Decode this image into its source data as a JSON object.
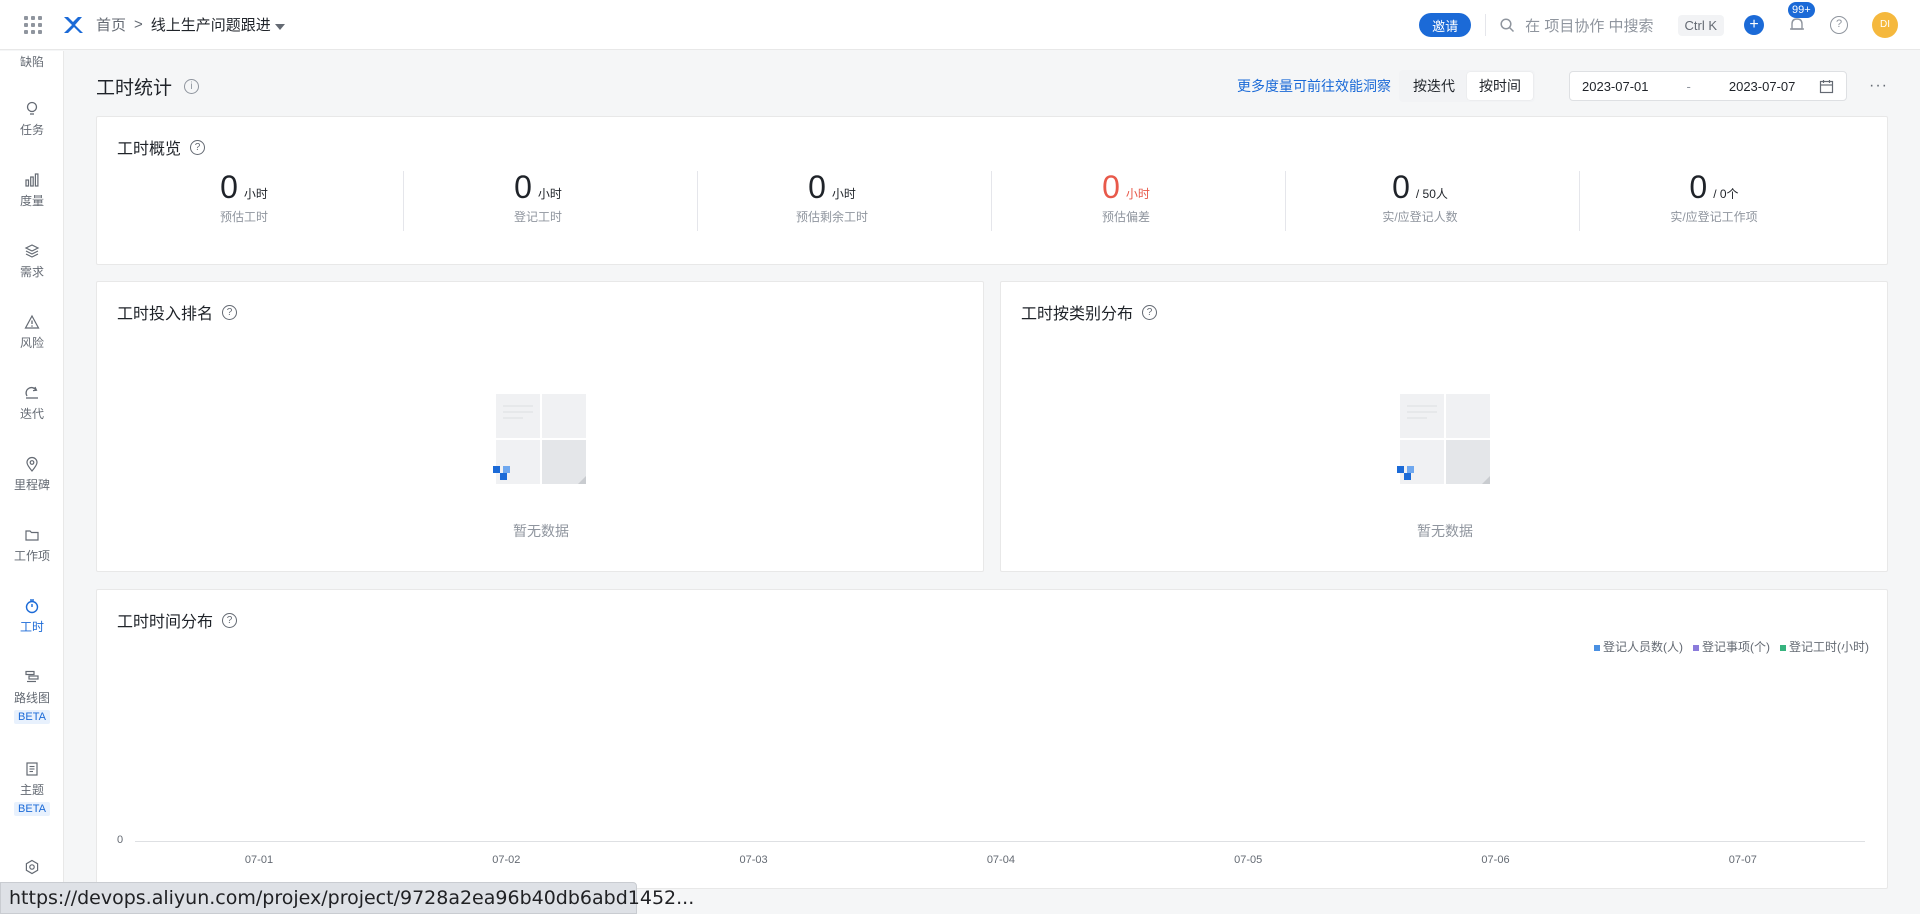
{
  "topbar": {
    "breadcrumb_home": "首页",
    "breadcrumb_sep": ">",
    "project_name": "线上生产问题跟进",
    "invite_label": "邀请",
    "search_placeholder": "在 项目协作 中搜索",
    "shortcut": "Ctrl K",
    "plus": "+",
    "notif_count": "99+",
    "help": "?",
    "avatar_initials": "DI"
  },
  "sidebar": {
    "items": [
      {
        "label": "缺陷",
        "icon": "bug-icon"
      },
      {
        "label": "任务",
        "icon": "bulb-icon"
      },
      {
        "label": "度量",
        "icon": "bar-chart-icon"
      },
      {
        "label": "需求",
        "icon": "layers-icon"
      },
      {
        "label": "风险",
        "icon": "warning-icon"
      },
      {
        "label": "迭代",
        "icon": "cycle-icon"
      },
      {
        "label": "里程碑",
        "icon": "location-icon"
      },
      {
        "label": "工作项",
        "icon": "folder-icon"
      },
      {
        "label": "工时",
        "icon": "timer-icon"
      },
      {
        "label": "路线图",
        "icon": "roadmap-icon",
        "badge": "BETA"
      },
      {
        "label": "主题",
        "icon": "document-icon",
        "badge": "BETA"
      },
      {
        "label": "",
        "icon": "settings-icon"
      }
    ]
  },
  "header": {
    "title": "工时统计",
    "info": "i",
    "more_link": "更多度量可前往效能洞察",
    "seg_iteration": "按迭代",
    "seg_time": "按时间",
    "date_start": "2023-07-01",
    "date_sep": "-",
    "date_end": "2023-07-07",
    "more_menu": "···"
  },
  "overview": {
    "title": "工时概览",
    "q": "?",
    "stats": [
      {
        "num": "0",
        "unit": "小时",
        "label": "预估工时"
      },
      {
        "num": "0",
        "unit": "小时",
        "label": "登记工时"
      },
      {
        "num": "0",
        "unit": "小时",
        "label": "预估剩余工时"
      },
      {
        "num": "0",
        "unit": "小时",
        "label": "预估偏差",
        "color": "#e8594a"
      },
      {
        "num": "0",
        "unit": "/ 50人",
        "label": "实/应登记人数"
      },
      {
        "num": "0",
        "unit": "/ 0个",
        "label": "实/应登记工作项"
      }
    ]
  },
  "ranking": {
    "title": "工时投入排名",
    "q": "?",
    "empty": "暂无数据"
  },
  "category": {
    "title": "工时按类别分布",
    "q": "?",
    "empty": "暂无数据"
  },
  "timeline": {
    "title": "工时时间分布",
    "q": "?"
  },
  "chart_data": {
    "type": "bar",
    "categories": [
      "07-01",
      "07-02",
      "07-03",
      "07-04",
      "07-05",
      "07-06",
      "07-07"
    ],
    "series": [
      {
        "name": "登记人员数(人)",
        "color": "#4a90e2",
        "values": [
          0,
          0,
          0,
          0,
          0,
          0,
          0
        ]
      },
      {
        "name": "登记事项(个)",
        "color": "#8b7bdb",
        "values": [
          0,
          0,
          0,
          0,
          0,
          0,
          0
        ]
      },
      {
        "name": "登记工时(小时)",
        "color": "#36b37e",
        "values": [
          0,
          0,
          0,
          0,
          0,
          0,
          0
        ]
      }
    ],
    "yticks": [
      "0"
    ],
    "legend": "top-right"
  },
  "status_url": "https://devops.aliyun.com/projex/project/9728a2ea96b40db6abd1452..."
}
